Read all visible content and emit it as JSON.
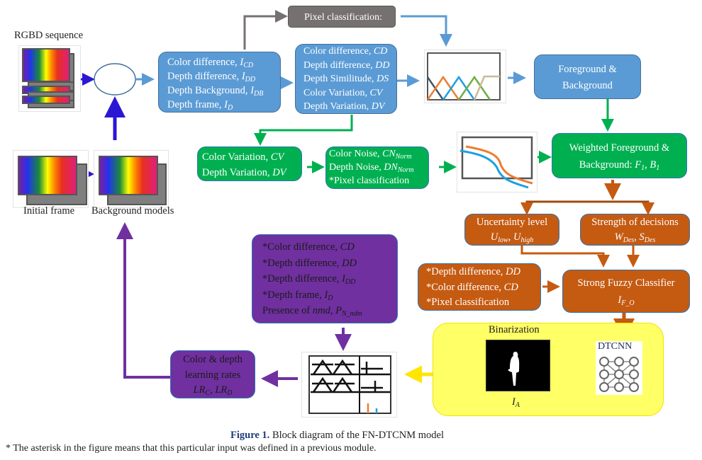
{
  "inputs": {
    "rgbd_sequence_label": "RGBD sequence",
    "initial_frame_label": "Initial frame",
    "background_models_label": "Background models"
  },
  "pixel_classification": {
    "label": "Pixel classification:"
  },
  "input_features": {
    "lines": [
      {
        "text": "Color difference, ",
        "sym": "I",
        "sub": "CD"
      },
      {
        "text": "Depth difference, ",
        "sym": "I",
        "sub": "DD"
      },
      {
        "text": "Depth Background, ",
        "sym": "I",
        "sub": "DB"
      },
      {
        "text": "Depth frame, ",
        "sym": "I",
        "sub": "D"
      }
    ]
  },
  "derived_features": {
    "lines": [
      {
        "text": "Color difference, ",
        "sym": "CD"
      },
      {
        "text": "Depth difference, ",
        "sym": "DD"
      },
      {
        "text": "Depth Similitude, ",
        "sym": "DS"
      },
      {
        "text": "Color Variation, ",
        "sym": "CV"
      },
      {
        "text": "Depth Variation, ",
        "sym": "DV"
      }
    ]
  },
  "foreground_background": {
    "line1": "Foreground &",
    "line2": "Background"
  },
  "variation": {
    "lines": [
      {
        "text": "Color Variation, ",
        "sym": "CV"
      },
      {
        "text": "Depth Variation, ",
        "sym": "DV"
      }
    ]
  },
  "noise": {
    "lines": [
      {
        "text": "Color Noise, ",
        "sym": "CN",
        "sub": "Norm"
      },
      {
        "text": "Depth Noise, ",
        "sym": "DN",
        "sub": "Norm"
      },
      {
        "text": "*Pixel classification"
      }
    ]
  },
  "weighted": {
    "line1": "Weighted Foreground &",
    "line2_text": "Background: ",
    "f_sym": "F",
    "f_sub": "1",
    "sep": ", ",
    "b_sym": "B",
    "b_sub": "1"
  },
  "uncertainty": {
    "title": "Uncertainty level",
    "sym1": "U",
    "sub1": "low",
    "sep": ", ",
    "sym2": "U",
    "sub2": "high"
  },
  "strength": {
    "title": "Strength of decisions",
    "sym1": "W",
    "sub1": "Des",
    "sep": ", ",
    "sym2": "S",
    "sub2": "Des"
  },
  "classifier_inputs": {
    "lines": [
      {
        "text": "*Depth difference, ",
        "sym": "DD"
      },
      {
        "text": "*Color difference, ",
        "sym": "CD"
      },
      {
        "text": "*Pixel classification"
      }
    ]
  },
  "strong_fuzzy": {
    "title": "Strong Fuzzy Classifier",
    "sym": "I",
    "sub": "F_O"
  },
  "purple_inputs": {
    "lines": [
      {
        "text": "*Color difference, ",
        "sym": "CD"
      },
      {
        "text": "*Depth difference, ",
        "sym": "DD"
      },
      {
        "text": "*Depth difference, ",
        "sym": "I",
        "sub": "DD"
      },
      {
        "text": "*Depth frame, ",
        "sym": "I",
        "sub": "D"
      },
      {
        "text": "Presence of ",
        "mid": "nmd",
        "text2": ", ",
        "sym": "P",
        "sub": "N_ndm"
      }
    ]
  },
  "binarization": {
    "title": "Binarization",
    "output_sym": "I",
    "output_sub": "A",
    "network_label": "DTCNN"
  },
  "learning_rates": {
    "line1": "Color & depth",
    "line2": "learning rates",
    "sym1": "LR",
    "sub1": "C",
    "sep": ", ",
    "sym2": "LR",
    "sub2": "D"
  },
  "caption": {
    "figure_label": "Figure 1.",
    "figure_text": " Block diagram of the FN-DTCNM model",
    "footnote": "* The asterisk in the figure means that this particular input was defined in a previous module."
  },
  "colors": {
    "blue_box": "#5b9bd5",
    "green_box": "#00b050",
    "orange_box": "#c55a11",
    "purple_box": "#7030a0",
    "gray_box": "#767171",
    "yellow_panel": "#ffff66",
    "arrow_dark_blue": "#2b16d4",
    "arrow_green": "#00b050",
    "arrow_orange": "#c55a11",
    "arrow_purple": "#7030a0",
    "arrow_yellow": "#ffe500"
  }
}
